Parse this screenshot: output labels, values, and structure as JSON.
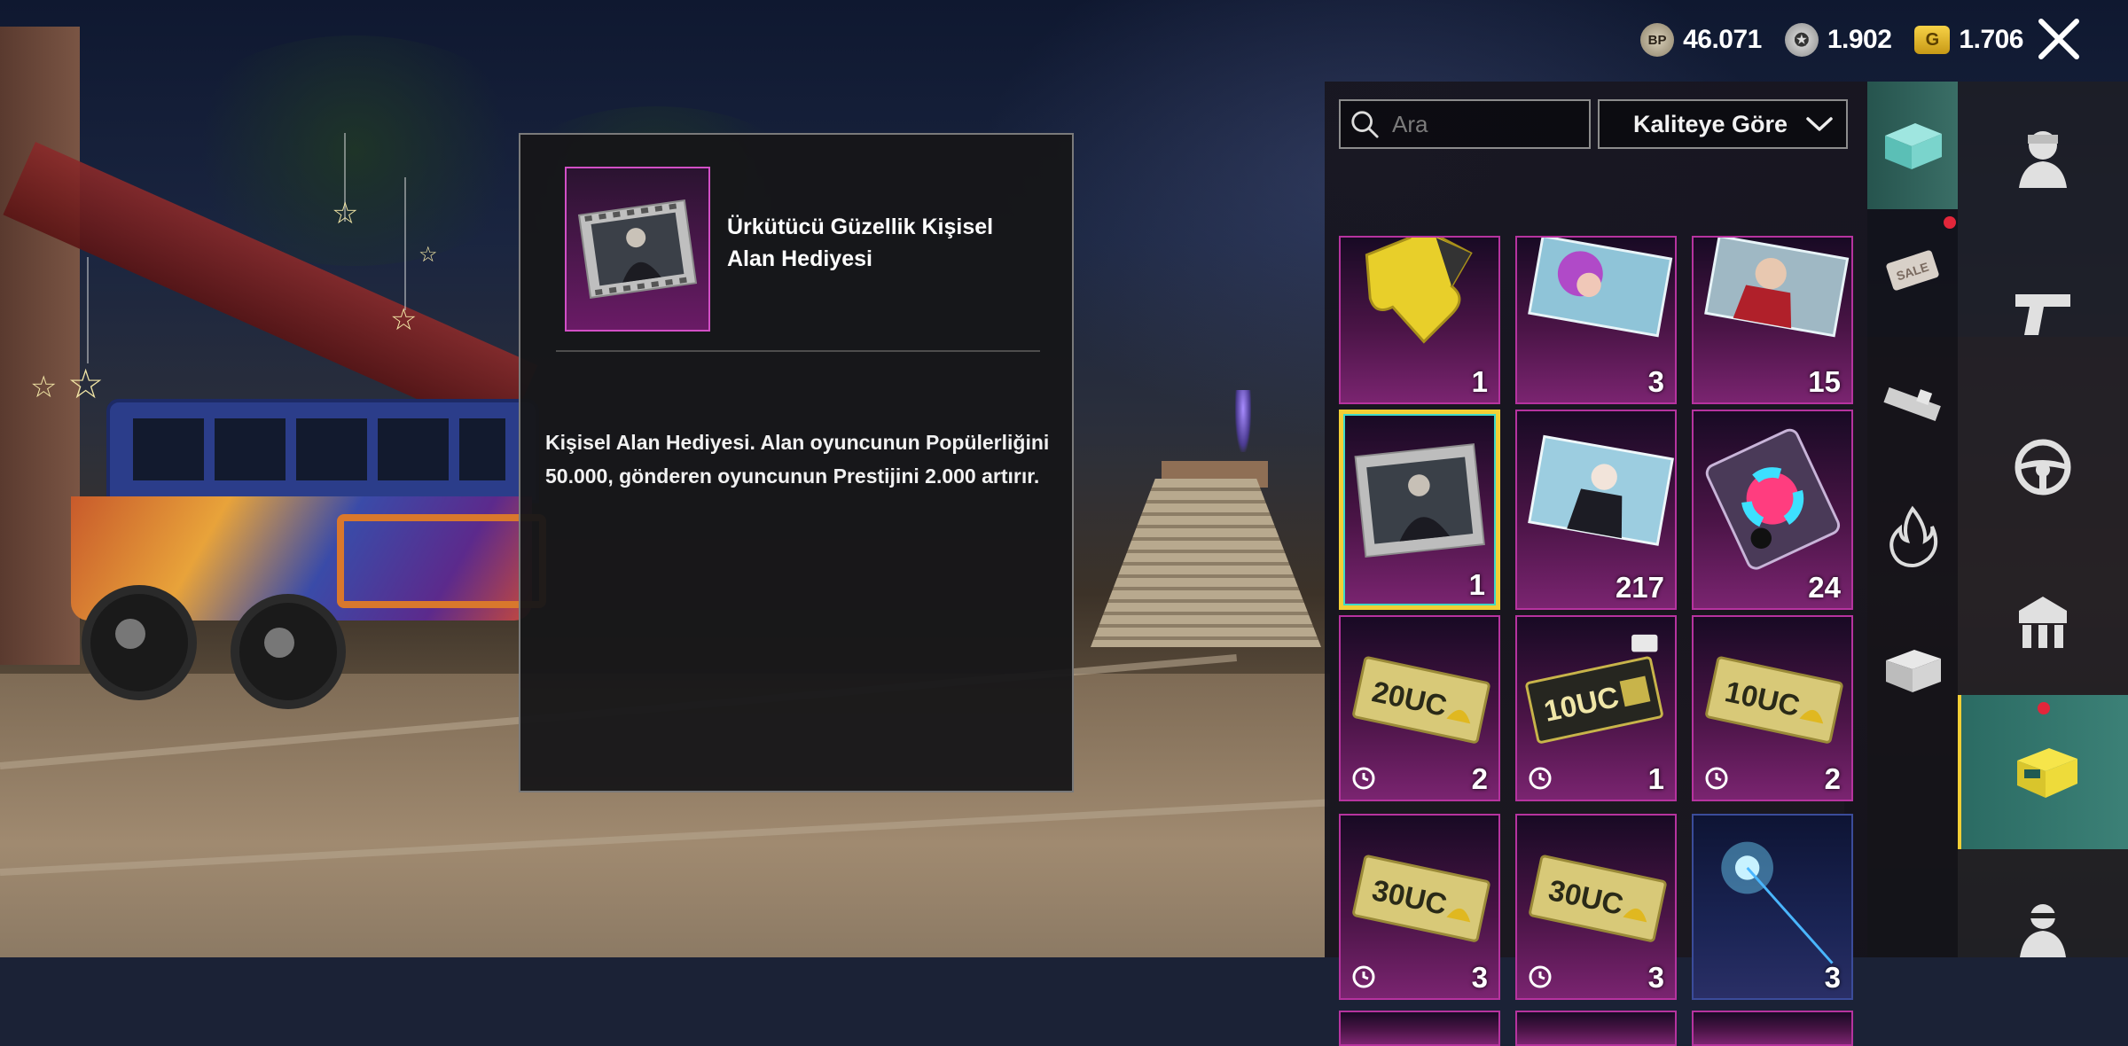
{
  "currency": {
    "bp_icon": "BP",
    "bp_value": "46.071",
    "ag_icon": "ag-coin-icon",
    "ag_value": "1.902",
    "g_icon": "G",
    "uc_value": "1.706"
  },
  "detail": {
    "item_name": "Ürkütücü Güzellik Kişisel Alan Hediyesi",
    "description": "Kişisel Alan Hediyesi. Alan oyuncunun Popülerliğini 50.000, gönderen oyuncunun Prestijini 2.000 artırır."
  },
  "filters": {
    "search_placeholder": "Ara",
    "sort_label": "Kaliteye Göre"
  },
  "inventory": {
    "items": [
      {
        "name": "puzzle-piece",
        "count": "1",
        "timed": false
      },
      {
        "name": "avatar-card-purple-hair",
        "count": "3",
        "timed": false
      },
      {
        "name": "avatar-card-red-scarf",
        "count": "15",
        "timed": false
      },
      {
        "name": "space-gift-film",
        "count": "1",
        "timed": false,
        "selected": true
      },
      {
        "name": "avatar-card-suit",
        "count": "217",
        "timed": false
      },
      {
        "name": "color-palette-card",
        "count": "24",
        "timed": false
      },
      {
        "name": "uc-voucher",
        "label": "20UC",
        "count": "2",
        "timed": true
      },
      {
        "name": "uc-voucher",
        "label": "10UC",
        "count": "1",
        "timed": true
      },
      {
        "name": "uc-voucher",
        "label": "10UC",
        "count": "2",
        "timed": true
      },
      {
        "name": "uc-voucher",
        "label": "30UC",
        "count": "3",
        "timed": true
      },
      {
        "name": "uc-voucher",
        "label": "30UC",
        "count": "3",
        "timed": true
      },
      {
        "name": "sparkle-wand",
        "count": "3",
        "timed": false
      }
    ]
  },
  "nav": {
    "categories": [
      "crate-icon",
      "sale-icon",
      "ammo-icon",
      "fire-icon",
      "box-icon"
    ],
    "main": [
      "character-icon",
      "pistol-icon",
      "steering-wheel-icon",
      "shield-icon",
      "chest-icon",
      "agent-icon"
    ]
  },
  "colors": {
    "rarity_purple": "#b6339f",
    "selection_yellow": "#f3cf35",
    "active_teal": "#3c8177"
  }
}
